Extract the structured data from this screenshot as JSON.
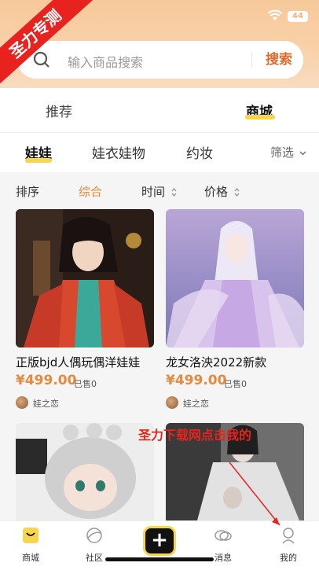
{
  "status": {
    "battery": "44"
  },
  "ribbon": "圣力专测",
  "search": {
    "placeholder": "输入商品搜索",
    "button": "搜索"
  },
  "top_tabs": [
    "推荐",
    "商城"
  ],
  "categories": {
    "items": [
      "娃娃",
      "娃衣娃物",
      "约妆"
    ],
    "filter": "筛选"
  },
  "sort": {
    "items": [
      "排序",
      "综合",
      "时间",
      "价格"
    ]
  },
  "products": [
    {
      "title": "正版bjd人偶玩偶洋娃娃",
      "price": "¥499.00",
      "sold": "已售0",
      "seller": "娃之恋"
    },
    {
      "title": "龙女洛泱2022新款",
      "price": "¥499.00",
      "sold": "已售0",
      "seller": "娃之恋"
    },
    {
      "title": "",
      "price": "",
      "sold": "",
      "seller": ""
    },
    {
      "title": "",
      "price": "",
      "sold": "",
      "seller": ""
    }
  ],
  "watermark": "圣力下载网点击我的",
  "bottom_nav": {
    "items": [
      "商城",
      "社区",
      "消息",
      "我的"
    ]
  },
  "colors": {
    "accent": "#f8d54a",
    "price": "#e58a3e",
    "search_btn": "#e06a2a",
    "ribbon": "#e8231f"
  }
}
